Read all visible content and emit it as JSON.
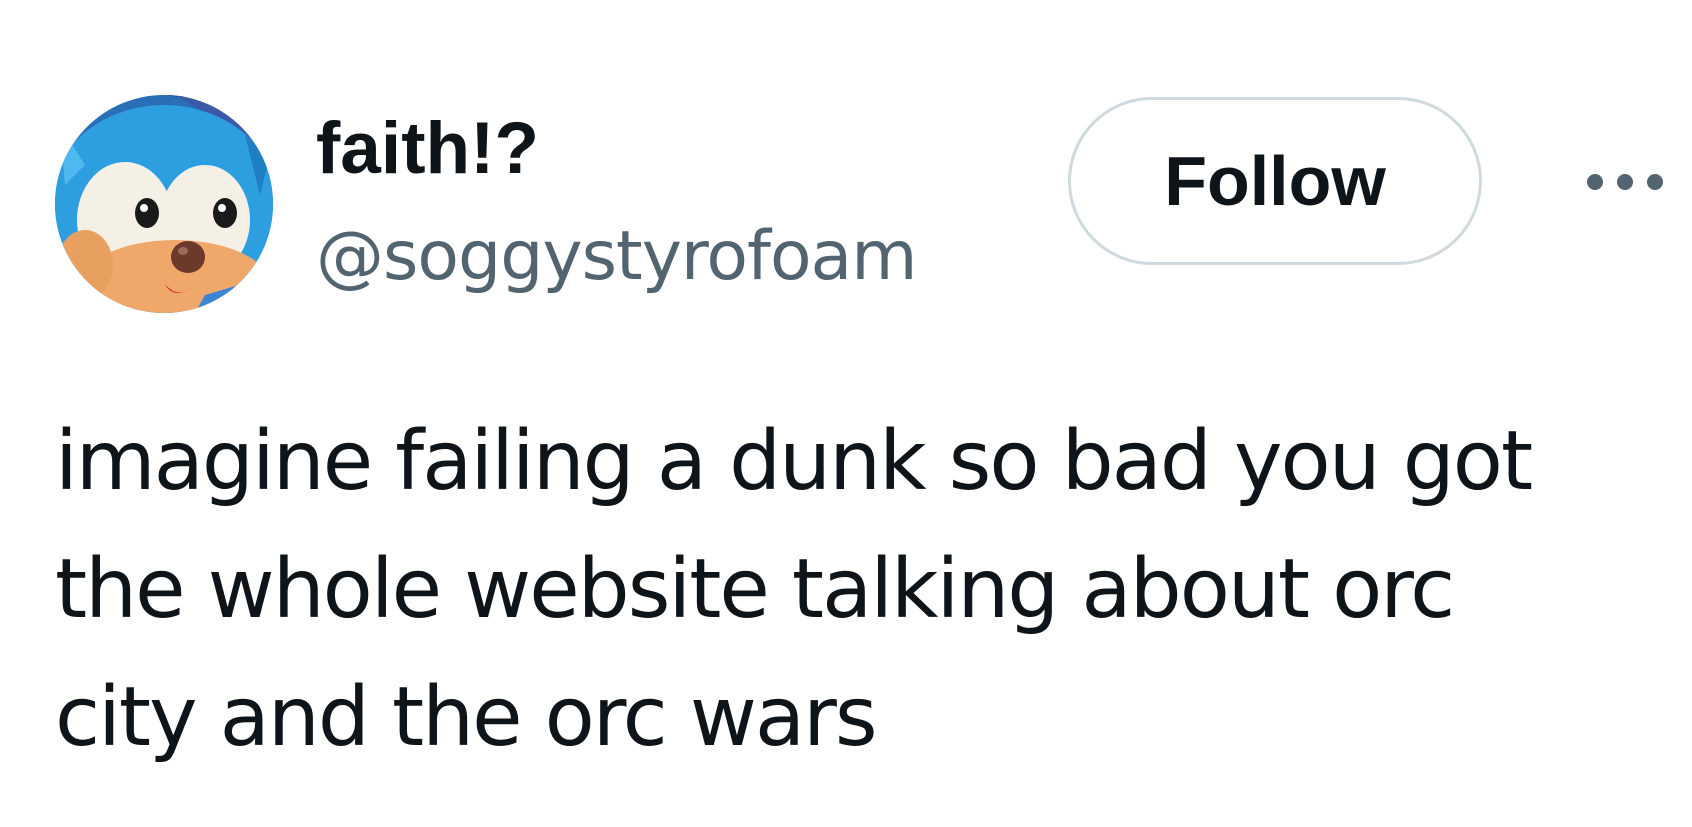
{
  "author": {
    "display_name": "faith!?",
    "handle": "@soggystyrofoam",
    "avatar_icon": "plush-hedgehog-avatar"
  },
  "actions": {
    "follow_label": "Follow",
    "more_icon": "more-horizontal-icon"
  },
  "tweet": {
    "lines": [
      "imagine failing a dunk so bad you got",
      "the whole website talking about orc",
      "city and the orc wars"
    ]
  },
  "colors": {
    "text_primary": "#0f1419",
    "text_secondary": "#536471",
    "button_border": "#cfd9de",
    "background": "#ffffff"
  }
}
